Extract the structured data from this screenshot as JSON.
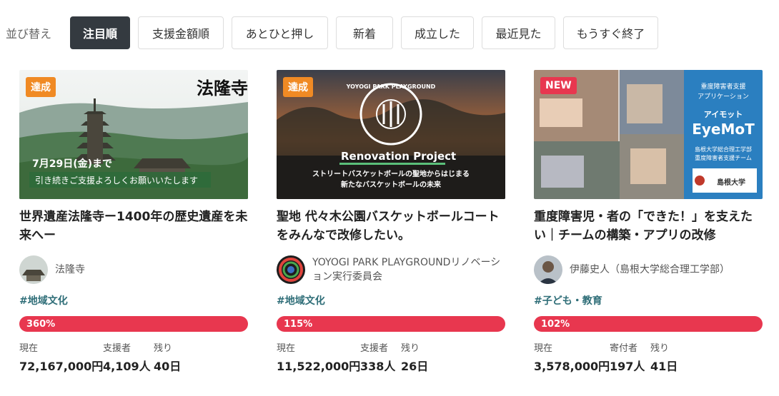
{
  "sort": {
    "label": "並び替え",
    "options": [
      "注目順",
      "支援金額順",
      "あとひと押し",
      "新着",
      "成立した",
      "最近見た",
      "もうすぐ終了"
    ],
    "active": "注目順"
  },
  "projects": [
    {
      "badge": "達成",
      "badge_color": "#f08a24",
      "image_text": {
        "temple": "法隆寺",
        "date": "7月29日(金)まで",
        "message": "引き続きご支援よろしくお願いいたします"
      },
      "title": "世界遺産法隆寺ー1400年の歴史遺産を未来へー",
      "owner": "法隆寺",
      "tag": "#地域文化",
      "progress_label": "360%",
      "progress": 3.6,
      "stat1_label": "現在",
      "stat1_value": "72,167,000円",
      "stat2_label": "支援者",
      "stat2_value": "4,109人",
      "stat3_label": "残り",
      "stat3_value": "40日"
    },
    {
      "badge": "達成",
      "badge_color": "#f08a24",
      "image_text": {
        "logo": "YOYOGI PARK PLAYGROUND",
        "heading": "Renovation Project",
        "line1": "ストリートバスケットボールの聖地からはじまる",
        "line2": "新たなバスケットボールの未来"
      },
      "title": "聖地 代々木公園バスケットボールコートをみんなで改修したい。",
      "owner": "YOYOGI PARK PLAYGROUNDリノベーション実行委員会",
      "tag": "#地域文化",
      "progress_label": "115%",
      "progress": 1.15,
      "stat1_label": "現在",
      "stat1_value": "11,522,000円",
      "stat2_label": "支援者",
      "stat2_value": "338人",
      "stat3_label": "残り",
      "stat3_value": "26日"
    },
    {
      "badge": "NEW",
      "badge_color": "#e8374f",
      "image_text": {
        "sub1": "重度障害者支援",
        "sub2": "アプリケーション",
        "app": "アイモット",
        "name": "EyeMoT",
        "org1": "島根大学総合理工学部",
        "org2": "重度障害者支援チーム",
        "seal": "島根大学"
      },
      "title": "重度障害児・者の「できた！」を支えたい｜チームの構築・アプリの改修",
      "owner": "伊藤史人（島根大学総合理工学部）",
      "tag": "#子ども・教育",
      "progress_label": "102%",
      "progress": 1.02,
      "stat1_label": "現在",
      "stat1_value": "3,578,000円",
      "stat2_label": "寄付者",
      "stat2_value": "197人",
      "stat3_label": "残り",
      "stat3_value": "41日"
    }
  ]
}
